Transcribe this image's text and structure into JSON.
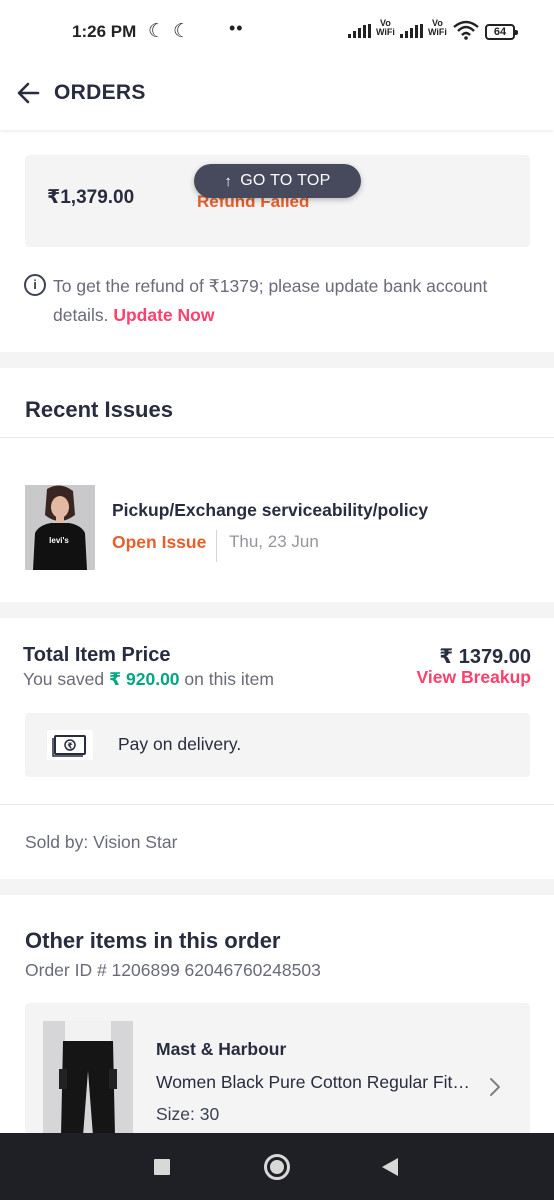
{
  "status_bar": {
    "time": "1:26 PM",
    "network_labels": [
      "Vo\nWiFi",
      "Vo\nWiFi"
    ],
    "battery": "64",
    "icons": [
      "moon-icon",
      "moon-icon",
      "more-dots-icon",
      "signal-icon",
      "signal-icon",
      "wifi-icon",
      "battery-icon"
    ]
  },
  "header": {
    "title": "ORDERS",
    "back_icon": "arrow-left-icon"
  },
  "refund": {
    "amount": "₹1,379.00",
    "status": "Refund Failed",
    "status_color": "#e5602b",
    "info_text": "To get the refund of ₹1379; please update bank account details.",
    "update_link": "Update Now",
    "link_color": "#ff3f6c"
  },
  "go_to_top": {
    "label": "GO TO TOP",
    "arrow": "↑"
  },
  "recent_issues": {
    "title": "Recent Issues",
    "items": [
      {
        "title": "Pickup/Exchange serviceability/policy",
        "status": "Open Issue",
        "date": "Thu, 23 Jun",
        "thumb_text": "levi's"
      }
    ]
  },
  "price": {
    "label": "Total Item Price",
    "saved_prefix": "You saved",
    "saved_amount": "₹ 920.00",
    "saved_suffix": "on this item",
    "total": "₹ 1379.00",
    "breakup_link": "View Breakup",
    "saved_color": "#03a685"
  },
  "payment": {
    "icon": "cash-icon",
    "text": "Pay on delivery."
  },
  "seller": {
    "text": "Sold by: Vision Star"
  },
  "other_items": {
    "title": "Other items in this order",
    "order_id": "Order ID # 1206899 62046760248503",
    "items": [
      {
        "brand": "Mast & Harbour",
        "name": "Women Black Pure Cotton Regular Fit Cargos",
        "size": "Size: 30"
      }
    ]
  },
  "nav_bar": {
    "buttons": [
      "recents-square-icon",
      "home-circle-icon",
      "back-triangle-icon"
    ]
  }
}
